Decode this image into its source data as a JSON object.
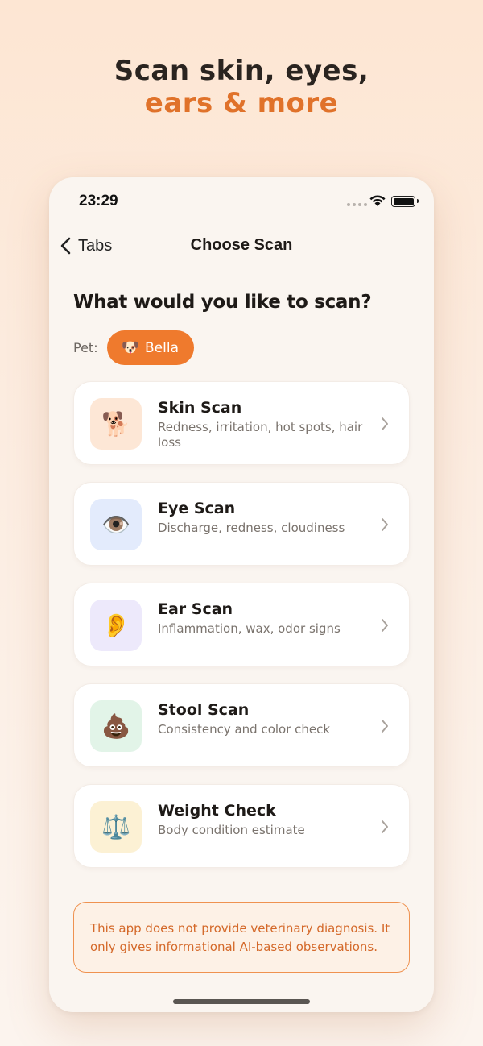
{
  "hero": {
    "line1": "Scan skin, eyes,",
    "line2": "ears & more"
  },
  "status_bar": {
    "time": "23:29"
  },
  "nav": {
    "back_label": "Tabs",
    "title": "Choose Scan"
  },
  "heading": "What would you like to scan?",
  "pet": {
    "label": "Pet:",
    "emoji": "🐶",
    "name": "Bella"
  },
  "scans": [
    {
      "icon": "dog-icon",
      "emoji": "🐕",
      "tile_color": "#fde7d6",
      "title": "Skin Scan",
      "subtitle": "Redness, irritation, hot spots, hair loss"
    },
    {
      "icon": "eye-icon",
      "emoji": "👁️",
      "tile_color": "#e3ebfc",
      "title": "Eye Scan",
      "subtitle": "Discharge, redness, cloudiness"
    },
    {
      "icon": "ear-icon",
      "emoji": "👂",
      "tile_color": "#ede9fb",
      "title": "Ear Scan",
      "subtitle": "Inflammation, wax, odor signs"
    },
    {
      "icon": "poop-icon",
      "emoji": "💩",
      "tile_color": "#e2f4e8",
      "title": "Stool Scan",
      "subtitle": "Consistency and color check"
    },
    {
      "icon": "scale-icon",
      "emoji": "⚖️",
      "tile_color": "#fcf1d4",
      "title": "Weight Check",
      "subtitle": "Body condition estimate"
    }
  ],
  "disclaimer": "This app does not provide veterinary diagnosis. It only gives informational AI-based observations.",
  "colors": {
    "accent": "#ef7a2d",
    "hero_accent": "#e0722a",
    "disclaimer_text": "#d4692a"
  }
}
